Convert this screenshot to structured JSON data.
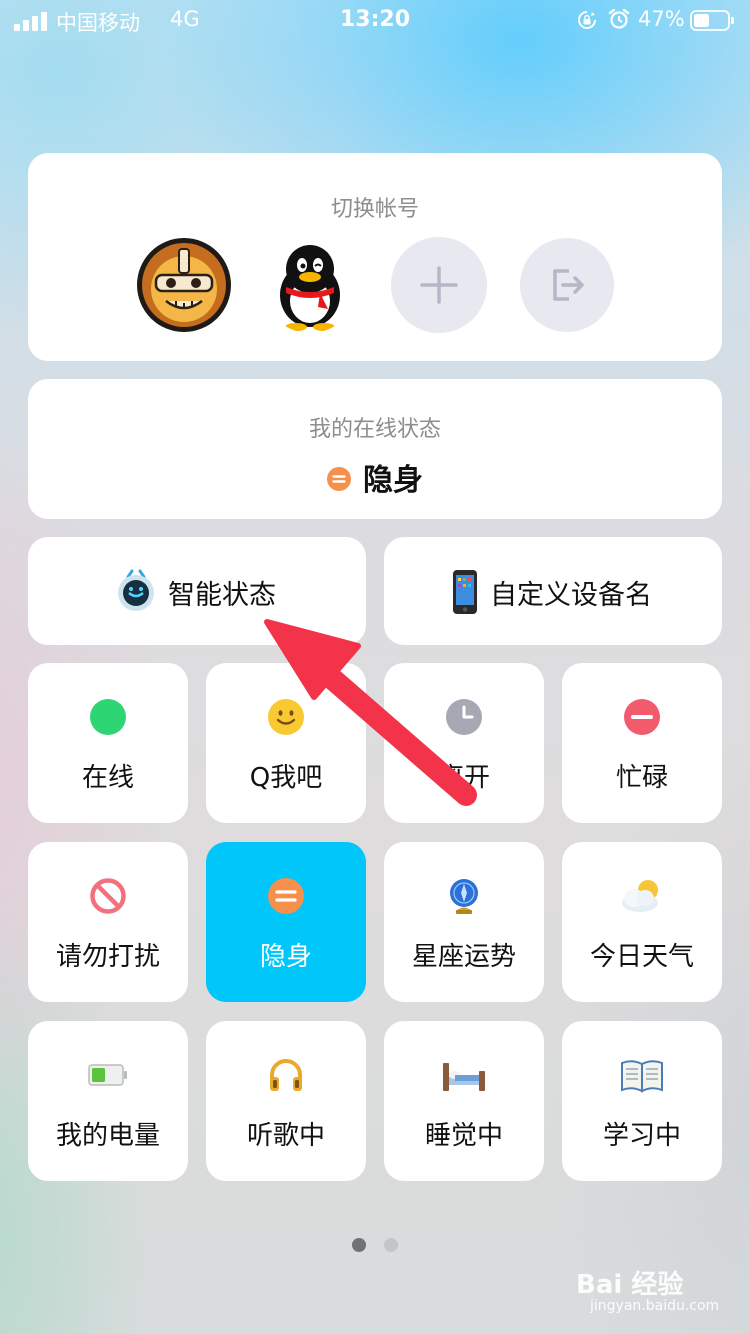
{
  "status_bar": {
    "carrier": "中国移动",
    "network": "4G",
    "time": "13:20",
    "battery": "47%",
    "icons": [
      "signal-icon",
      "rotation-lock-icon",
      "alarm-icon",
      "battery-icon"
    ]
  },
  "account": {
    "title": "切换帐号",
    "avatars": [
      "lion-avatar",
      "qq-penguin-avatar"
    ],
    "add_icon": "plus-icon",
    "logout_icon": "logout-icon"
  },
  "online_status": {
    "title": "我的在线状态",
    "value": "隐身",
    "color": "#f5914d"
  },
  "shortcuts": {
    "smart_status": "智能状态",
    "device_name": "自定义设备名"
  },
  "tiles": [
    {
      "label": "在线",
      "icon": "green-dot-icon",
      "color": "#2ed573"
    },
    {
      "label": "Q我吧",
      "icon": "smiley-icon",
      "color": "#f9c932"
    },
    {
      "label": "离开",
      "icon": "clock-icon",
      "color": "#a8a8b4"
    },
    {
      "label": "忙碌",
      "icon": "minus-circle-icon",
      "color": "#f15b6c"
    },
    {
      "label": "请勿打扰",
      "icon": "no-entry-icon",
      "color": "#f3707d"
    },
    {
      "label": "隐身",
      "icon": "invisible-icon",
      "color": "#f5914d",
      "active": true
    },
    {
      "label": "星座运势",
      "icon": "crystal-ball-icon",
      "color": "#2f6fd6"
    },
    {
      "label": "今日天气",
      "icon": "weather-icon",
      "color": "#f6c538"
    },
    {
      "label": "我的电量",
      "icon": "battery-level-icon",
      "color": "#5cc43c"
    },
    {
      "label": "听歌中",
      "icon": "headphones-icon",
      "color": "#e9a92c"
    },
    {
      "label": "睡觉中",
      "icon": "bed-icon",
      "color": "#8a5a3c"
    },
    {
      "label": "学习中",
      "icon": "book-icon",
      "color": "#4b7cb7"
    }
  ],
  "accent_color": "#00c6fa",
  "pager": {
    "count": 2,
    "current": 1
  },
  "watermark": {
    "logo": "Bai 经验",
    "text": "jingyan.baidu.com"
  }
}
